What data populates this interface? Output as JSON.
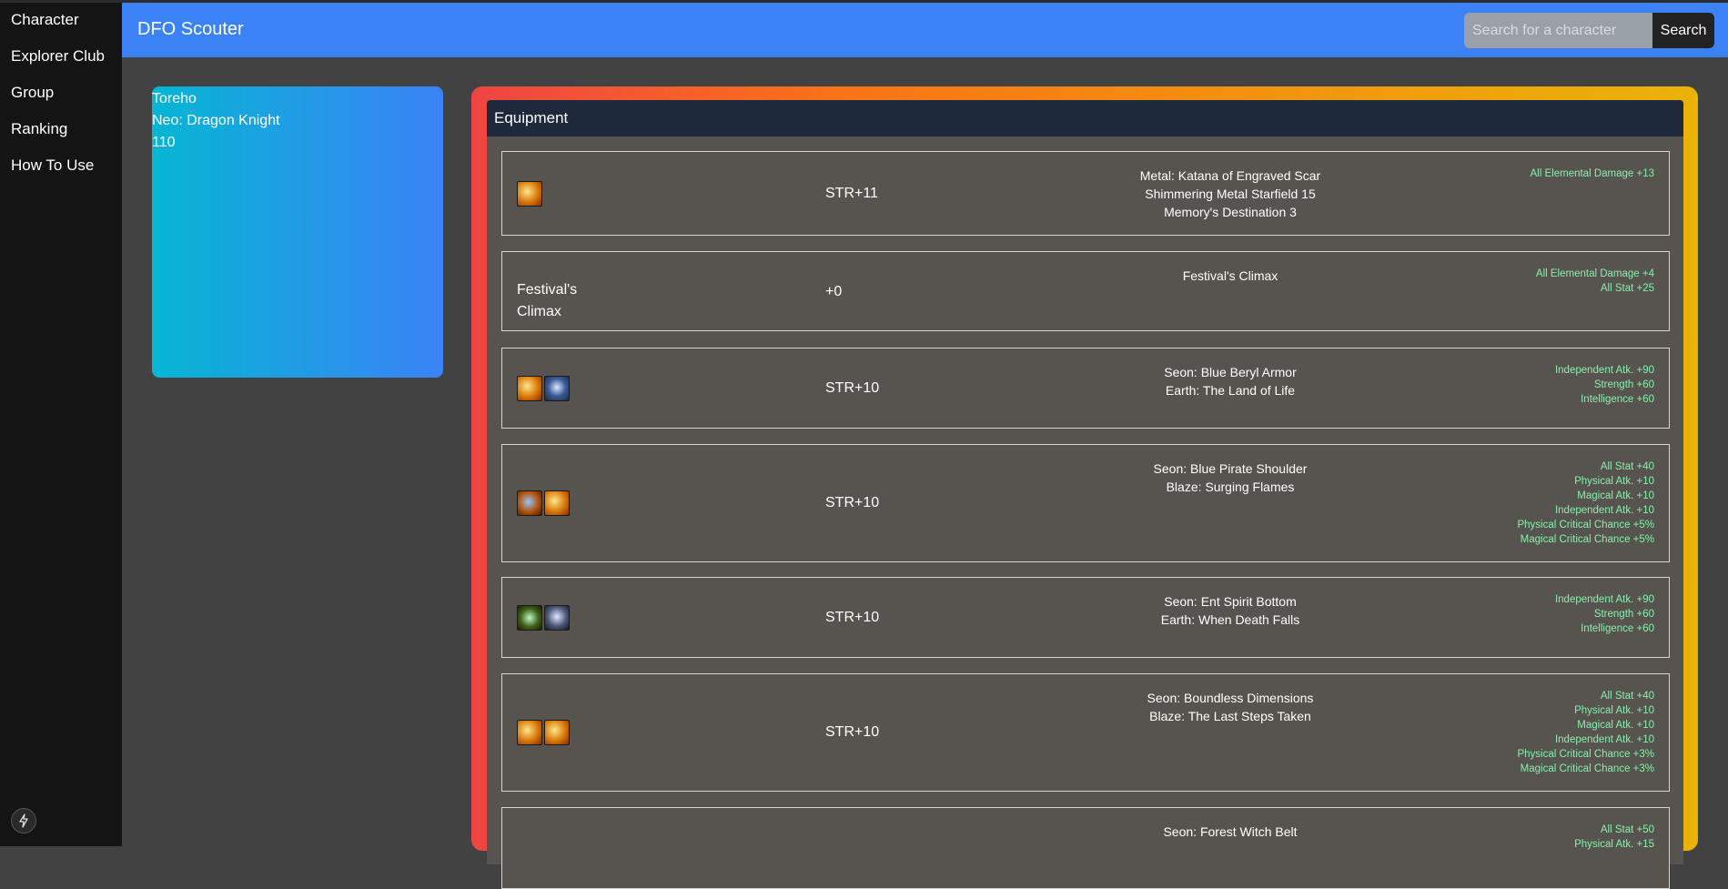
{
  "sidebar": {
    "items": [
      {
        "label": "Character"
      },
      {
        "label": "Explorer Club"
      },
      {
        "label": "Group"
      },
      {
        "label": "Ranking"
      },
      {
        "label": "How To Use"
      }
    ]
  },
  "header": {
    "title": "DFO Scouter",
    "search_placeholder": "Search for a character",
    "search_button": "Search"
  },
  "character": {
    "name": "Toreho",
    "job": "Neo: Dragon Knight",
    "level": "110"
  },
  "equipment": {
    "title": "Equipment",
    "items": [
      {
        "reinforce": "STR+11",
        "desc": [
          "Metal: Katana of Engraved Scar",
          "Shimmering Metal Starfield 15",
          "Memory's Destination 3"
        ],
        "stats": [
          "All Elemental Damage +13"
        ]
      },
      {
        "name": "Festival's Climax",
        "reinforce": "+0",
        "desc": [
          "Festival's Climax"
        ],
        "stats": [
          "All Elemental Damage +4",
          "All Stat +25"
        ]
      },
      {
        "reinforce": "STR+10",
        "desc": [
          "Seon: Blue Beryl Armor",
          "Earth: The Land of Life"
        ],
        "stats": [
          "Independent Atk. +90",
          "Strength +60",
          "Intelligence +60"
        ]
      },
      {
        "reinforce": "STR+10",
        "desc": [
          "Seon: Blue Pirate Shoulder",
          "Blaze: Surging Flames"
        ],
        "stats": [
          "All Stat +40",
          "Physical Atk. +10",
          "Magical Atk. +10",
          "Independent Atk. +10",
          "Physical Critical Chance +5%",
          "Magical Critical Chance +5%"
        ]
      },
      {
        "reinforce": "STR+10",
        "desc": [
          "Seon: Ent Spirit Bottom",
          "Earth: When Death Falls"
        ],
        "stats": [
          "Independent Atk. +90",
          "Strength +60",
          "Intelligence +60"
        ]
      },
      {
        "reinforce": "STR+10",
        "desc": [
          "Seon: Boundless Dimensions",
          "Blaze: The Last Steps Taken"
        ],
        "stats": [
          "All Stat +40",
          "Physical Atk. +10",
          "Magical Atk. +10",
          "Independent Atk. +10",
          "Physical Critical Chance +3%",
          "Magical Critical Chance +3%"
        ]
      },
      {
        "desc": [
          "Seon: Forest Witch Belt"
        ],
        "stats": [
          "All Stat +50",
          "Physical Atk. +15"
        ]
      }
    ]
  }
}
